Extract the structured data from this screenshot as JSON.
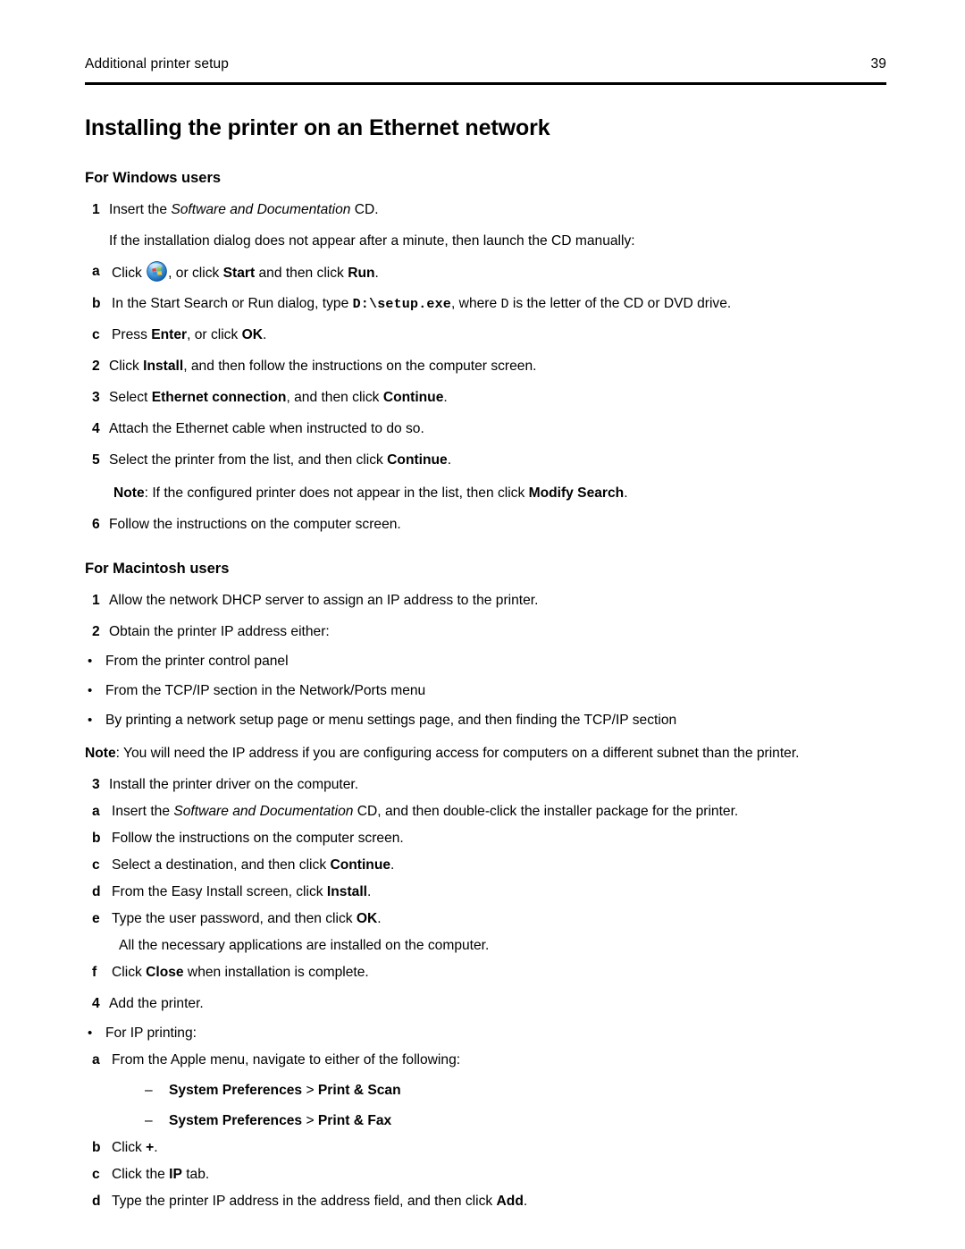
{
  "header": {
    "running_title": "Additional printer setup",
    "page_number": "39"
  },
  "chapter_title": "Installing the printer on an Ethernet network",
  "windows": {
    "section_title": "For Windows users",
    "step1": {
      "marker": "1",
      "pre": "Insert the ",
      "italic": "Software and Documentation",
      "post": " CD."
    },
    "step1_cont": "If the installation dialog does not appear after a minute, then launch the CD manually:",
    "step1a": {
      "marker": "a",
      "pre": "Click ",
      "icon": "windows-start-orb-icon",
      "mid": ", or click ",
      "bold1": "Start",
      "mid2": " and then click ",
      "bold2": "Run",
      "post": "."
    },
    "step1b": {
      "marker": "b",
      "pre": "In the Start Search or Run dialog, type ",
      "mono": "D:\\setup.exe",
      "mid": ", where ",
      "mono2": "D",
      "post": " is the letter of the CD or DVD drive."
    },
    "step1c": {
      "marker": "c",
      "pre": "Press ",
      "bold1": "Enter",
      "mid": ", or click ",
      "bold2": "OK",
      "post": "."
    },
    "step2": {
      "marker": "2",
      "pre": "Click ",
      "bold1": "Install",
      "post": ", and then follow the instructions on the computer screen."
    },
    "step3": {
      "marker": "3",
      "pre": "Select ",
      "bold1": "Ethernet connection",
      "mid": ", and then click ",
      "bold2": "Continue",
      "post": "."
    },
    "step4": {
      "marker": "4",
      "text": "Attach the Ethernet cable when instructed to do so."
    },
    "step5": {
      "marker": "5",
      "pre": "Select the printer from the list, and then click ",
      "bold1": "Continue",
      "post": "."
    },
    "step5_note": {
      "label": "Note",
      "pre": ": If the configured printer does not appear in the list, then click ",
      "bold1": "Modify Search",
      "post": "."
    },
    "step6": {
      "marker": "6",
      "text": "Follow the instructions on the computer screen."
    }
  },
  "macintosh": {
    "section_title": "For Macintosh users",
    "step1": {
      "marker": "1",
      "text": "Allow the network DHCP server to assign an IP address to the printer."
    },
    "step2": {
      "marker": "2",
      "text": "Obtain the printer IP address either:"
    },
    "step2_bullets": [
      {
        "marker": "•",
        "text": "From the printer control panel"
      },
      {
        "marker": "•",
        "text": "From the TCP/IP section in the Network/Ports menu"
      },
      {
        "marker": "•",
        "text": "By printing a network setup page or menu settings page, and then finding the TCP/IP section"
      }
    ],
    "note": {
      "label": "Note",
      "text": ": You will need the IP address if you are configuring access for computers on a different subnet than the printer."
    },
    "step3": {
      "marker": "3",
      "text": "Install the printer driver on the computer."
    },
    "step3a": {
      "marker": "a",
      "pre": "Insert the ",
      "italic": "Software and Documentation",
      "post": " CD, and then double-click the installer package for the printer."
    },
    "step3b": {
      "marker": "b",
      "text": "Follow the instructions on the computer screen."
    },
    "step3c": {
      "marker": "c",
      "pre": "Select a destination, and then click ",
      "bold1": "Continue",
      "post": "."
    },
    "step3d": {
      "marker": "d",
      "pre": "From the Easy Install screen, click ",
      "bold1": "Install",
      "post": "."
    },
    "step3e": {
      "marker": "e",
      "pre": "Type the user password, and then click ",
      "bold1": "OK",
      "post": "."
    },
    "step3e_cont": "All the necessary applications are installed on the computer.",
    "step3f": {
      "marker": "f",
      "pre": "Click ",
      "bold1": "Close",
      "post": " when installation is complete."
    },
    "step4": {
      "marker": "4",
      "text": "Add the printer."
    },
    "step4_bullet": {
      "marker": "•",
      "text": "For IP printing:"
    },
    "step4a": {
      "marker": "a",
      "text": "From the Apple menu, navigate to either of the following:"
    },
    "step4a_dashes": [
      {
        "marker": "–",
        "bold1": "System Preferences",
        "sep": " > ",
        "bold2": "Print & Scan"
      },
      {
        "marker": "–",
        "bold1": "System Preferences",
        "sep": " > ",
        "bold2": "Print & Fax"
      }
    ],
    "step4b": {
      "marker": "b",
      "pre": "Click ",
      "bold1": "+",
      "post": "."
    },
    "step4c": {
      "marker": "c",
      "pre": "Click the ",
      "bold1": "IP",
      "post": " tab."
    },
    "step4d": {
      "marker": "d",
      "pre": "Type the printer IP address in the address field, and then click ",
      "bold1": "Add",
      "post": "."
    }
  },
  "colors": {
    "text": "#000000",
    "rule": "#000000",
    "page_background": "#ffffff",
    "orb_blue_outer": "#1b6fc4",
    "orb_blue_inner": "#7fc2ef",
    "orb_red": "#e8403a",
    "orb_green": "#7ec63f",
    "orb_blue_flag": "#3b8fd4",
    "orb_yellow": "#f5c842"
  }
}
